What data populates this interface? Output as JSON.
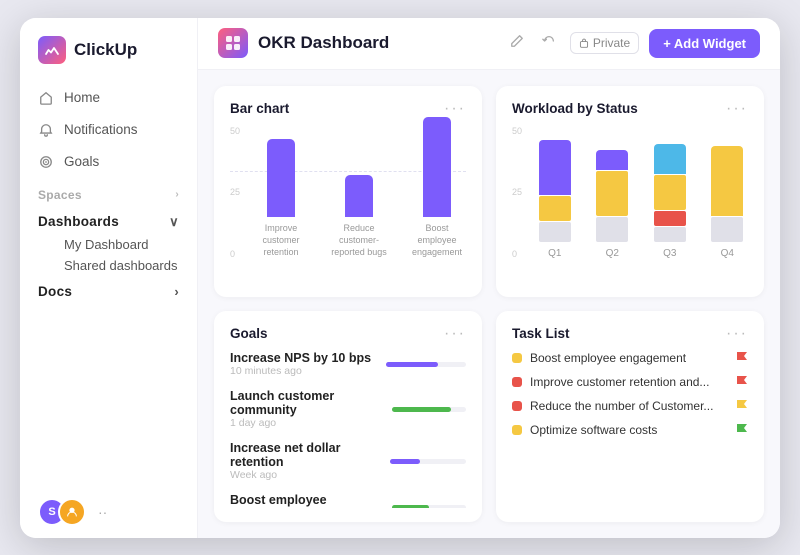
{
  "app": {
    "logo_text": "ClickUp"
  },
  "sidebar": {
    "nav_items": [
      {
        "id": "home",
        "label": "Home",
        "icon": "home-icon"
      },
      {
        "id": "notifications",
        "label": "Notifications",
        "icon": "bell-icon"
      },
      {
        "id": "goals",
        "label": "Goals",
        "icon": "target-icon"
      }
    ],
    "spaces_label": "Spaces",
    "dashboards_label": "Dashboards",
    "my_dashboard_label": "My Dashboard",
    "shared_dashboards_label": "Shared dashboards",
    "docs_label": "Docs"
  },
  "topbar": {
    "title": "OKR Dashboard",
    "private_label": "Private",
    "add_widget_label": "+ Add Widget"
  },
  "bar_chart": {
    "title": "Bar chart",
    "more": "···",
    "y_labels": [
      "50",
      "25",
      "0"
    ],
    "bars": [
      {
        "label": "Improve customer\nretention",
        "height": 85
      },
      {
        "label": "Reduce customer-\nreported bugs",
        "height": 45
      },
      {
        "label": "Boost employee\nengagement",
        "height": 110
      }
    ]
  },
  "workload_chart": {
    "title": "Workload by Status",
    "more": "···",
    "y_labels": [
      "50",
      "25",
      "0"
    ],
    "groups": [
      {
        "label": "Q1",
        "segments": [
          {
            "color": "#7c5cfc",
            "height": 55
          },
          {
            "color": "#f5c842",
            "height": 25
          },
          {
            "color": "#e0e0e8",
            "height": 20
          }
        ]
      },
      {
        "label": "Q2",
        "segments": [
          {
            "color": "#7c5cfc",
            "height": 20
          },
          {
            "color": "#f5c842",
            "height": 45
          },
          {
            "color": "#e0e0e8",
            "height": 25
          }
        ]
      },
      {
        "label": "Q3",
        "segments": [
          {
            "color": "#4db8e8",
            "height": 30
          },
          {
            "color": "#f5c842",
            "height": 35
          },
          {
            "color": "#e8534a",
            "height": 15
          },
          {
            "color": "#e0e0e8",
            "height": 15
          }
        ]
      },
      {
        "label": "Q4",
        "segments": [
          {
            "color": "#f5c842",
            "height": 70
          },
          {
            "color": "#e0e0e8",
            "height": 25
          }
        ]
      }
    ]
  },
  "goals_widget": {
    "title": "Goals",
    "more": "···",
    "items": [
      {
        "name": "Increase NPS by 10 bps",
        "time": "10 minutes ago",
        "fill_pct": 65,
        "color": "#7c5cfc"
      },
      {
        "name": "Launch customer community",
        "time": "1 day ago",
        "fill_pct": 80,
        "color": "#4db84d"
      },
      {
        "name": "Increase net dollar retention",
        "time": "Week ago",
        "fill_pct": 40,
        "color": "#7c5cfc"
      },
      {
        "name": "Boost employee engagement",
        "time": "",
        "fill_pct": 50,
        "color": "#4db84d"
      }
    ]
  },
  "task_list_widget": {
    "title": "Task List",
    "more": "···",
    "items": [
      {
        "name": "Boost employee engagement",
        "dot_color": "#f5c842",
        "flag_color": "#e8534a"
      },
      {
        "name": "Improve customer retention and...",
        "dot_color": "#e8534a",
        "flag_color": "#e8534a"
      },
      {
        "name": "Reduce the number of Customer...",
        "dot_color": "#e8534a",
        "flag_color": "#f5c842"
      },
      {
        "name": "Optimize software costs",
        "dot_color": "#f5c842",
        "flag_color": "#4db84d"
      }
    ]
  }
}
